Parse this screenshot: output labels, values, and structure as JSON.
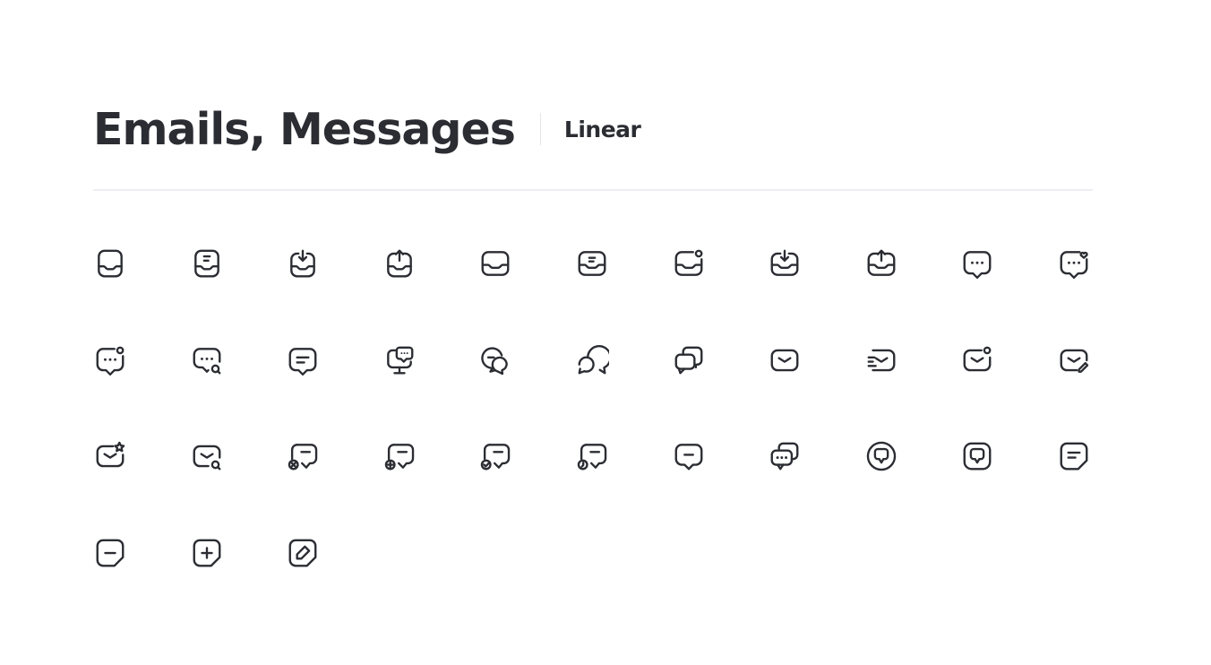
{
  "header": {
    "title": "Emails, Messages",
    "style_label": "Linear"
  },
  "icon_color": "#2b2d33",
  "icons": [
    "inbox",
    "inbox-text",
    "inbox-in",
    "inbox-out",
    "tray",
    "tray-text",
    "tray-notification",
    "tray-in",
    "tray-out",
    "chat-dots",
    "chat-dots-heart",
    "chat-dots-notification",
    "chat-dots-search",
    "chat-lines",
    "monitor-chat",
    "chats-round-line",
    "chats-round",
    "chats-square",
    "letter",
    "letter-fast",
    "letter-notification",
    "letter-edit",
    "letter-star",
    "letter-search",
    "chat-line-remove",
    "chat-line-add",
    "chat-line-check",
    "chat-line-clock",
    "chat-line",
    "chats-dots",
    "chat-round-circle",
    "chat-round-square",
    "notes",
    "square-minus",
    "square-plus",
    "square-pen"
  ]
}
